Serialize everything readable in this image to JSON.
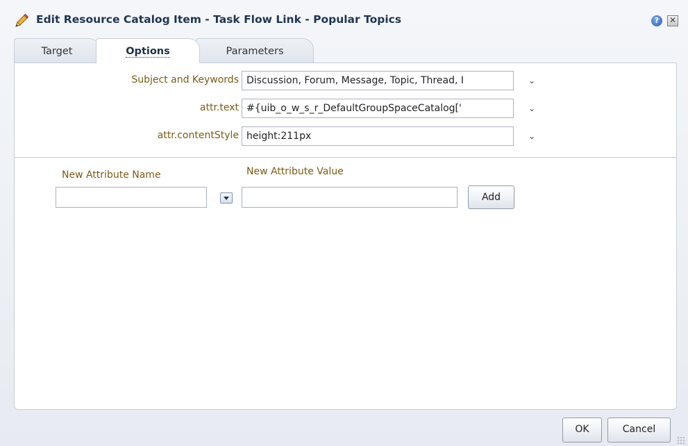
{
  "dialog": {
    "title": "Edit Resource Catalog Item - Task Flow Link - Popular Topics",
    "help_symbol": "?",
    "close_symbol": "✕"
  },
  "tabs": [
    {
      "label": "Target",
      "active": false
    },
    {
      "label": "Options",
      "active": true
    },
    {
      "label": "Parameters",
      "active": false
    }
  ],
  "options": {
    "rows": [
      {
        "label": "Subject and Keywords",
        "value": "Discussion, Forum, Message, Topic, Thread, I"
      },
      {
        "label": "attr.text",
        "value": "#{uib_o_w_s_r_DefaultGroupSpaceCatalog['"
      },
      {
        "label": "attr.contentStyle",
        "value": "height:211px"
      }
    ],
    "chevron": "⌄"
  },
  "new_attribute": {
    "name_label": "New Attribute Name",
    "value_label": "New Attribute Value",
    "name_value": "",
    "value_value": "",
    "add_label": "Add"
  },
  "footer": {
    "ok_label": "OK",
    "cancel_label": "Cancel"
  },
  "colors": {
    "title": "#1f3552",
    "field_label": "#7a5b14"
  },
  "icons": {
    "title": "pencil-icon",
    "help": "help-icon",
    "close": "close-icon",
    "row_menu": "chevron-down-icon",
    "dropdown": "dropdown-arrow-icon"
  }
}
